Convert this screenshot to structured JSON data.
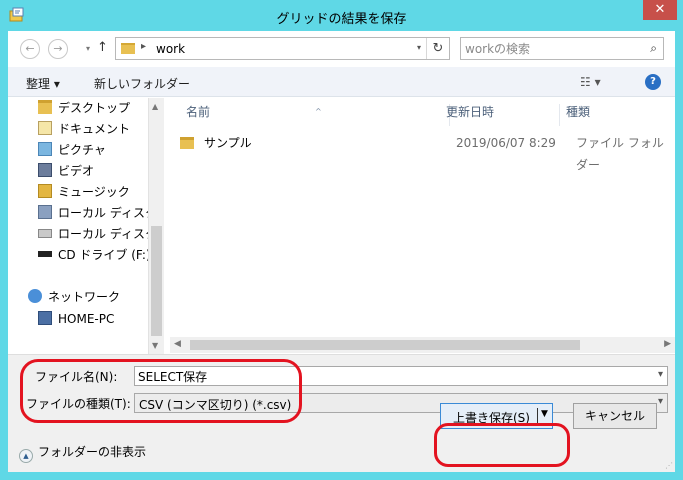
{
  "window": {
    "title": "グリッドの結果を保存",
    "close_glyph": "✕"
  },
  "nav": {
    "back_glyph": "←",
    "forward_glyph": "→",
    "recent_glyph": "▾",
    "up_glyph": "↑",
    "address_sep": "▸",
    "address_path": "work",
    "address_dd_glyph": "▾",
    "refresh_glyph": "↻",
    "search_placeholder": "workの検索",
    "search_glyph": "⌕"
  },
  "toolbar": {
    "organize_label": "整理 ▾",
    "new_folder_label": "新しいフォルダー",
    "view_glyph": "☷ ▾",
    "help_glyph": "?"
  },
  "sidebar": {
    "items": [
      {
        "label": "デスクトップ",
        "icon": "folder-icon"
      },
      {
        "label": "ドキュメント",
        "icon": "documents-icon"
      },
      {
        "label": "ピクチャ",
        "icon": "pictures-icon"
      },
      {
        "label": "ビデオ",
        "icon": "videos-icon"
      },
      {
        "label": "ミュージック",
        "icon": "music-icon"
      },
      {
        "label": "ローカル ディスク (C",
        "icon": "disk-c-icon"
      },
      {
        "label": "ローカル ディスク (D",
        "icon": "disk-d-icon"
      },
      {
        "label": "CD ドライブ (F:) S",
        "icon": "cd-drive-icon"
      },
      {
        "label": "ネットワーク",
        "icon": "network-icon"
      },
      {
        "label": "HOME-PC",
        "icon": "computer-icon"
      }
    ],
    "scroll_up": "▲",
    "scroll_down": "▼"
  },
  "files": {
    "sort_caret": "^",
    "columns": {
      "name": "名前",
      "date": "更新日時",
      "type": "種類"
    },
    "rows": [
      {
        "name": "サンプル",
        "date": "2019/06/07 8:29",
        "type": "ファイル フォルダー"
      }
    ],
    "scroll_left": "◀",
    "scroll_right": "▶"
  },
  "form": {
    "filename_label": "ファイル名(N):",
    "filename_value": "SELECT保存",
    "filetype_label": "ファイルの種類(T):",
    "filetype_value": "CSV (コンマ区切り) (*.csv)",
    "chevron": "▾"
  },
  "footer": {
    "hide_folders_glyph": "▲",
    "hide_folders_label": "フォルダーの非表示",
    "save_label": "上書き保存(S)",
    "save_dd_glyph": "▼",
    "cancel_label": "キャンセル",
    "grip_glyph": "⋰"
  },
  "colors": {
    "frame": "#5fd8e6",
    "close_button": "#c7504a",
    "highlight": "#e31320",
    "default_button_border": "#3a8ad6"
  }
}
